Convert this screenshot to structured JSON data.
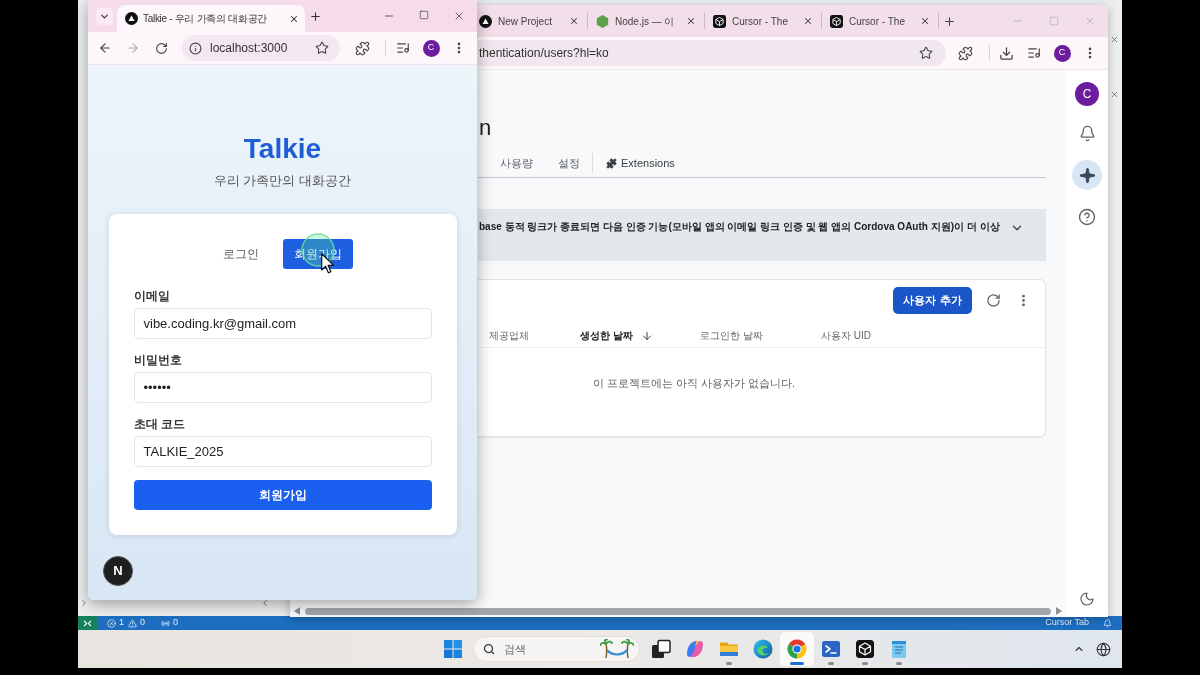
{
  "front_window": {
    "tab": {
      "kind": "triangle",
      "title": "Talkie - 우리 가족의 대화공간"
    },
    "toolbar": {
      "forward_disabled": true,
      "address": "localhost:3000",
      "avatar": "C"
    },
    "app": {
      "title": "Talkie",
      "subtitle": "우리 가족만의 대화공간",
      "mode_tabs": [
        {
          "label": "로그인",
          "selected": false
        },
        {
          "label": "회원가입",
          "selected": true
        }
      ],
      "fields": [
        {
          "label": "이메일",
          "value": "vibe.coding.kr@gmail.com"
        },
        {
          "label": "비밀번호",
          "value": "••••••"
        },
        {
          "label": "초대 코드",
          "value": "TALKIE_2025"
        }
      ],
      "submit_button": "회원가입",
      "dev_badge": "N"
    }
  },
  "back_window": {
    "tabs": [
      {
        "kind": "triangle",
        "title": "New Project"
      },
      {
        "kind": "hexagon",
        "title": "Node.js — 이"
      },
      {
        "kind": "cube",
        "title": "Cursor - The"
      },
      {
        "kind": "cube",
        "title": "Cursor - The"
      }
    ],
    "toolbar": {
      "address": "thentication/users?hl=ko",
      "avatar": "C"
    },
    "page": {
      "title": "n",
      "tabs": [
        {
          "kind": "text",
          "label": "사용량"
        },
        {
          "kind": "text",
          "label": "설정"
        },
        {
          "kind": "extension",
          "label": "Extensions"
        }
      ],
      "banner": "base 동적 링크가 종료되면 다음 인증 기능(모바일 앱의 이메일 링크 인증 및 웹 앱의 Cordova OAuth 지원)이 더 이상",
      "users": {
        "add_button": "사용자 추가",
        "columns": [
          {
            "label": "제공업체",
            "sorted": false
          },
          {
            "label": "생성한 날짜",
            "sorted": true
          },
          {
            "label": "로그인한 날짜",
            "sorted": false
          },
          {
            "label": "사용자 UID",
            "sorted": false
          }
        ],
        "empty_message": "이 프로젝트에는 아직 사용자가 없습니다."
      }
    },
    "rail": {
      "avatar": "C",
      "items": [
        {
          "kind": "bell",
          "selected": false
        },
        {
          "kind": "sparkle",
          "selected": true
        },
        {
          "kind": "help",
          "selected": false
        }
      ]
    }
  },
  "status_bar": {
    "items": [
      {
        "kind": "errors",
        "text": "1"
      },
      {
        "kind": "warnings",
        "text": "0"
      },
      {
        "kind": "ports",
        "text": "0"
      }
    ],
    "right": "Cursor Tab"
  },
  "taskbar": {
    "search": {
      "placeholder": "검색"
    },
    "apps": [
      {
        "kind": "squares",
        "running": false,
        "selected": false
      },
      {
        "kind": "swirl",
        "running": false,
        "selected": false
      },
      {
        "kind": "folder",
        "running": true,
        "selected": false
      },
      {
        "kind": "wave",
        "running": false,
        "selected": false
      },
      {
        "kind": "ring",
        "running": true,
        "selected": true
      },
      {
        "kind": "terminal",
        "running": true,
        "selected": false
      },
      {
        "kind": "cube",
        "running": true,
        "selected": false
      },
      {
        "kind": "notepad",
        "running": true,
        "selected": false
      }
    ]
  }
}
